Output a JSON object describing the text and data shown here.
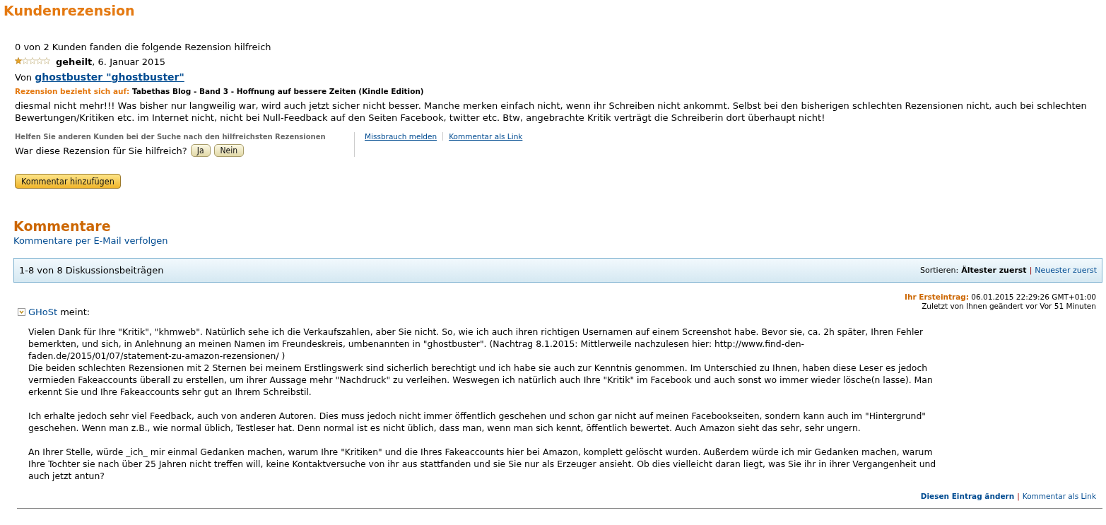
{
  "title": "Kundenrezension",
  "review": {
    "helpful_count": "0 von 2 Kunden fanden die folgende Rezension hilfreich",
    "stars": 1,
    "headline": "geheilt",
    "date": ", 6. Januar 2015",
    "by_label": "Von",
    "author": "ghostbuster \"ghostbuster\"",
    "refers_label": "Rezension bezieht sich auf:",
    "product": "Tabethas Blog - Band 3 - Hoffnung auf bessere Zeiten (Kindle Edition)",
    "text": "diesmal nicht mehr!!! Was bisher nur langweilig war, wird auch jetzt sicher nicht besser. Manche merken einfach nicht, wenn ihr Schreiben nicht ankommt. Selbst bei den bisherigen schlechten Rezensionen nicht, auch bei schlechten Bewertungen/Kritiken etc. im Internet nicht, nicht bei Null-Feedback auf den Seiten Facebook, twitter etc. Btw, angebrachte Kritik verträgt die Schreiberin dort überhaupt nicht!",
    "help_prompt": "Helfen Sie anderen Kunden bei der Suche nach den hilfreichsten Rezensionen",
    "question": "War diese Rezension für Sie hilfreich?",
    "vote_buttons": [
      "Ja",
      "Nein"
    ],
    "links": [
      "Missbrauch melden",
      "Kommentar als Link"
    ],
    "add_comment_button": "Kommentar hinzufügen"
  },
  "comments": {
    "title": "Kommentare",
    "follow_link": "Kommentare per E-Mail verfolgen",
    "count": "1-8 von 8 Diskussionsbeiträgen",
    "sort_label": "Sortieren:",
    "sort_separator": "|",
    "sort_options": [
      {
        "label": "Ältester zuerst",
        "selected": true
      },
      {
        "label": "Neuester zuerst",
        "selected": false
      }
    ],
    "posts": [
      {
        "first_entry_label": "Ihr Ersteintrag:",
        "first_entry": "06.01.2015 22:29:26 GMT+01:00",
        "edited": "Zuletzt von Ihnen geändert vor Vor 51 Minuten",
        "author": "GHoSt",
        "says": "meint:",
        "expanded": true,
        "paragraphs": [
          [
            "Vielen Dank für Ihre \"Kritik\", \"khmweb\". Natürlich sehe ich die Verkaufszahlen, aber Sie nicht. So, wie ich auch ihren richtigen Usernamen auf einem Screenshot habe. Bevor sie, ca. 2h später, Ihren Fehler bemerkten, und sich, in Anlehnung an meinen Namen im Freundeskreis, umbenannten in \"ghostbuster\". (Nachtrag 8.1.2015: Mittlerweile nachzulesen hier: http://www.find-den-faden.de/2015/01/07/statement-zu-amazon-rezensionen/ )",
            "Die beiden schlechten Rezensionen mit 2 Sternen bei meinem Erstlingswerk sind sicherlich berechtigt und ich habe sie auch zur Kenntnis genommen. Im Unterschied zu Ihnen, haben diese Leser es jedoch vermieden Fakeaccounts überall zu erstellen, um ihrer Aussage mehr \"Nachdruck\" zu verleihen. Weswegen ich natürlich auch Ihre \"Kritik\" im Facebook und auch sonst wo immer wieder lösche(n lasse). Man erkennt Sie und Ihre Fakeaccounts sehr gut an Ihrem Schreibstil."
          ],
          [
            "Ich erhalte jedoch sehr viel Feedback, auch von anderen Autoren. Dies muss jedoch nicht immer öffentlich geschehen und schon gar nicht auf meinen Facebookseiten, sondern kann auch im \"Hintergrund\" geschehen. Wenn man z.B., wie normal üblich, Testleser hat. Denn normal ist es nicht üblich, dass man, wenn man sich kennt, öffentlich bewertet. Auch Amazon sieht das sehr, sehr ungern."
          ],
          [
            "An Ihrer Stelle, würde _ich_ mir einmal Gedanken machen, warum Ihre \"Kritiken\" und die Ihres Fakeaccounts hier bei Amazon, komplett gelöscht wurden. Außerdem würde ich mir Gedanken machen, warum Ihre Tochter sie nach über 25 Jahren nicht treffen will, keine Kontaktversuche von ihr aus stattfanden und sie Sie nur als Erzeuger ansieht. Ob dies vielleicht daran liegt, was Sie ihr in ihrer Vergangenheit und auch jetzt antun?"
          ]
        ],
        "actions": [
          "Diesen Eintrag ändern",
          "Kommentar als Link"
        ],
        "actions_separator": "|"
      }
    ]
  }
}
